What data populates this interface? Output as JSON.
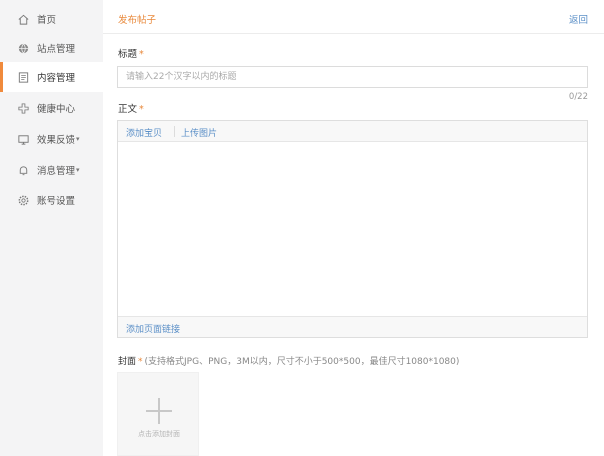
{
  "sidebar": {
    "items": [
      {
        "label": "首页",
        "icon": "home-icon"
      },
      {
        "label": "站点管理",
        "icon": "globe-icon"
      },
      {
        "label": "内容管理",
        "icon": "document-icon",
        "active": true
      },
      {
        "label": "健康中心",
        "icon": "health-cross-icon"
      },
      {
        "label": "效果反馈",
        "icon": "monitor-icon",
        "has_dropdown": true
      },
      {
        "label": "消息管理",
        "icon": "bell-icon",
        "has_dropdown": true
      },
      {
        "label": "账号设置",
        "icon": "gear-icon"
      }
    ],
    "active_color": "#f08a3c"
  },
  "header": {
    "title": "发布帖子",
    "back_label": "返回"
  },
  "form": {
    "title_label": "标题",
    "required_mark": "*",
    "title_placeholder": "请输入22个汉字以内的标题",
    "title_value": "",
    "counter": "0/22",
    "body_label": "正文",
    "toolbar": {
      "add_product": "添加宝贝",
      "upload_image": "上传图片"
    },
    "footer_link": "添加页面链接",
    "cover_label": "封面",
    "cover_hint": "(支持格式JPG、PNG，3M以内，尺寸不小于500*500，最佳尺寸1080*1080)",
    "cover_upload_text": "点击添加封面"
  },
  "colors": {
    "accent": "#e8883a",
    "link": "#5b8fc7",
    "sidebar_bg": "#f4f4f5"
  }
}
